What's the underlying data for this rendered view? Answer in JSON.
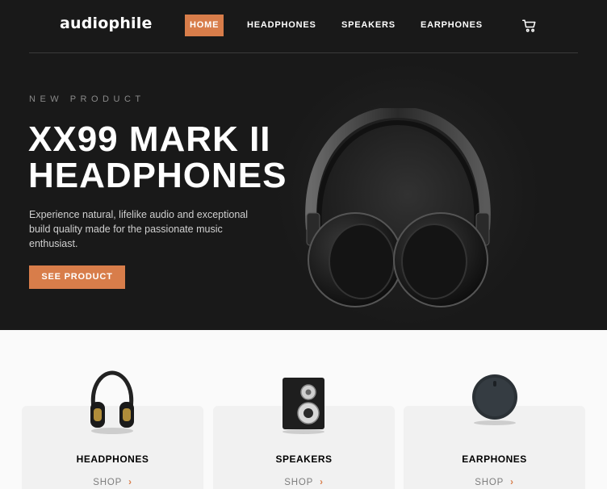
{
  "brand": {
    "logo": "audiophile"
  },
  "nav": {
    "items": [
      {
        "label": "HOME",
        "active": true
      },
      {
        "label": "HEADPHONES",
        "active": false
      },
      {
        "label": "SPEAKERS",
        "active": false
      },
      {
        "label": "EARPHONES",
        "active": false
      }
    ],
    "cart_icon": "cart-icon"
  },
  "hero": {
    "overline": "NEW PRODUCT",
    "title_line1": "XX99 MARK II",
    "title_line2": "HEADPHONES",
    "description": "Experience natural, lifelike audio and exceptional build quality made for the passionate music enthusiast.",
    "cta": "SEE PRODUCT"
  },
  "categories": [
    {
      "label": "HEADPHONES",
      "shop": "SHOP"
    },
    {
      "label": "SPEAKERS",
      "shop": "SHOP"
    },
    {
      "label": "EARPHONES",
      "shop": "SHOP"
    }
  ],
  "colors": {
    "accent": "#d87d4a",
    "dark": "#191919",
    "light": "#f1f1f1"
  }
}
